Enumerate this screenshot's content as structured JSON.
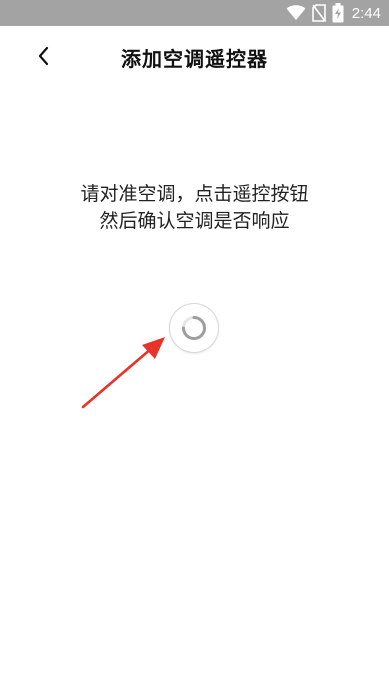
{
  "status_bar": {
    "time": "2:44",
    "icons": [
      "wifi-icon",
      "no-sim-icon",
      "battery-charging-icon"
    ]
  },
  "header": {
    "title": "添加空调遥控器",
    "back_icon": "chevron-left-icon"
  },
  "main": {
    "instruction_line1": "请对准空调，点击遥控按钮",
    "instruction_line2": "然后确认空调是否响应",
    "spinner_icon": "loading-spinner-icon",
    "arrow_color": "#e8332a"
  },
  "colors": {
    "status_bar_bg": "#a3a3a3",
    "background": "#ffffff",
    "text": "#111111",
    "spinner": "#9e9e9e"
  }
}
